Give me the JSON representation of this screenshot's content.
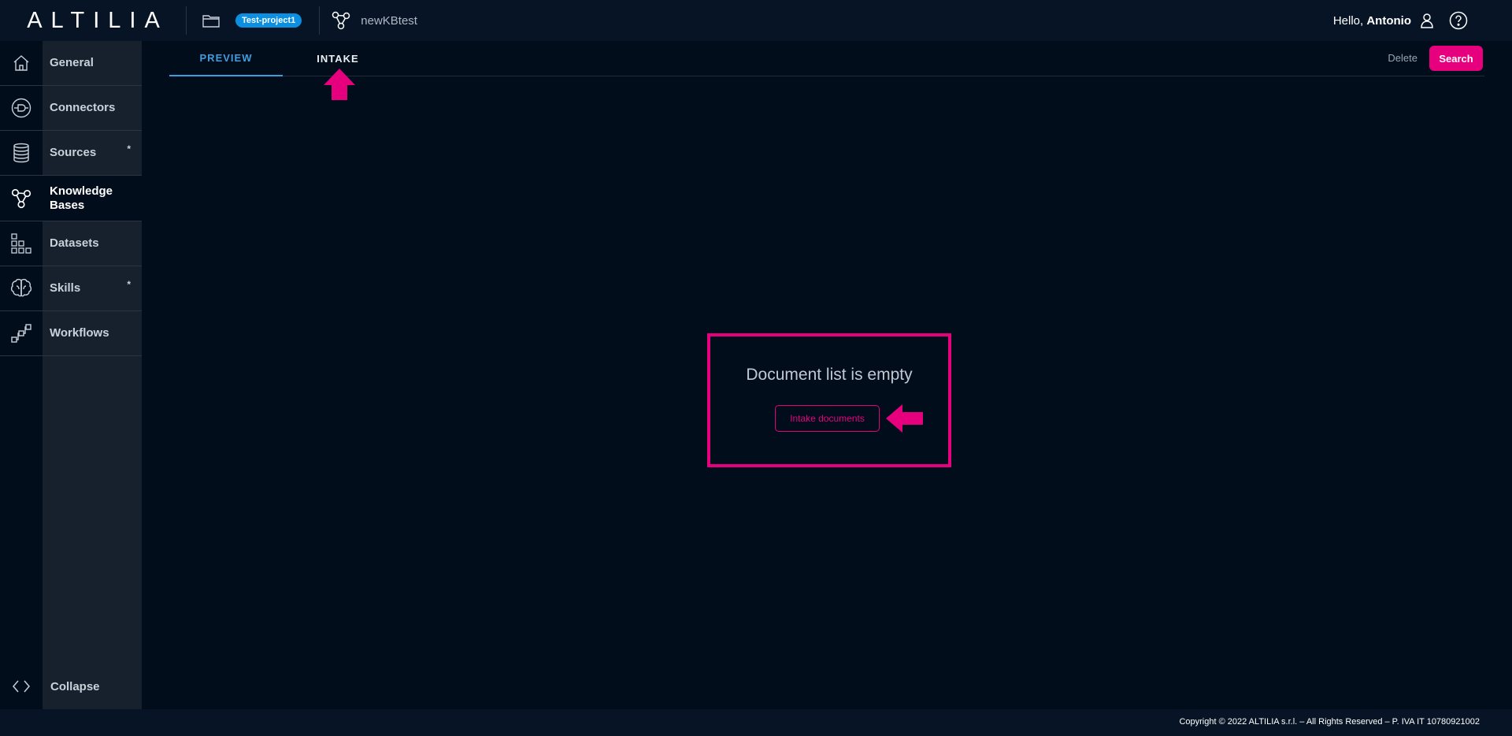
{
  "header": {
    "logo": "ALTILIA",
    "project_badge": "Test-project1",
    "kb_name": "newKBtest",
    "greeting": "Hello,",
    "user_name": "Antonio"
  },
  "sidebar": {
    "items": [
      {
        "label": "General",
        "icon": "home-icon"
      },
      {
        "label": "Connectors",
        "icon": "connector-icon"
      },
      {
        "label": "Sources",
        "icon": "database-icon",
        "marker": "*"
      },
      {
        "label": "Knowledge Bases",
        "icon": "graph-icon"
      },
      {
        "label": "Datasets",
        "icon": "grid-icon"
      },
      {
        "label": "Skills",
        "icon": "brain-icon",
        "marker": "*"
      },
      {
        "label": "Workflows",
        "icon": "workflow-icon"
      }
    ],
    "collapse_label": "Collapse"
  },
  "tabs": {
    "preview": "PREVIEW",
    "intake": "INTAKE"
  },
  "actions": {
    "delete": "Delete",
    "search": "Search"
  },
  "main": {
    "empty_message": "Document list is empty",
    "intake_button": "Intake documents"
  },
  "footer": {
    "copyright": "Copyright © 2022 ALTILIA s.r.l. – All Rights Reserved – P. IVA IT 10780921002"
  },
  "colors": {
    "accent": "#e6007e",
    "tab_active": "#3f9ddf",
    "badge": "#0b8fe0",
    "background": "#020d1c"
  }
}
